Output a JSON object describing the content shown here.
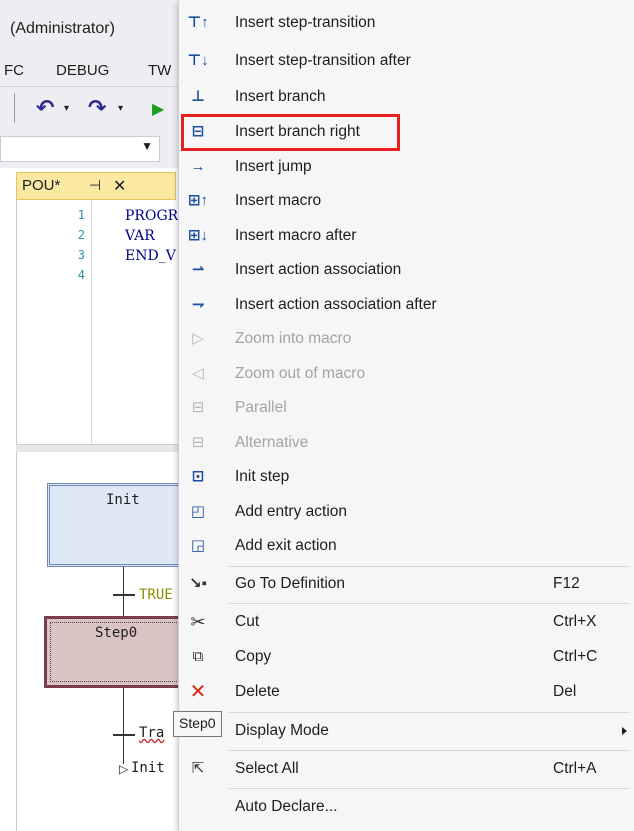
{
  "window": {
    "title": "(Administrator)"
  },
  "menubar": [
    "FC",
    "DEBUG",
    "TW"
  ],
  "toolbar": {
    "undo_icon": "undo-icon",
    "redo_icon": "redo-icon",
    "run_icon": "run-icon"
  },
  "editor": {
    "tab_label": "POU*",
    "line_numbers": [
      "1",
      "2",
      "3",
      "4"
    ],
    "code_lines": [
      "PROGR",
      "VAR",
      "END_V",
      ""
    ]
  },
  "sfc": {
    "init_step": "Init",
    "step0": "Step0",
    "transition_true": "TRUE",
    "transition_2": "Tra",
    "jump_target": "Init"
  },
  "tooltip": "Step0",
  "highlight_color": "#e81f1f",
  "context_menu": {
    "items": [
      {
        "label": "Insert step-transition",
        "icon": "insert-step-transition-icon",
        "enabled": true,
        "shortcut": ""
      },
      {
        "label": "Insert step-transition after",
        "icon": "insert-step-transition-after-icon",
        "enabled": true,
        "shortcut": ""
      },
      {
        "label": "Insert branch",
        "icon": "insert-branch-icon",
        "enabled": true,
        "shortcut": ""
      },
      {
        "label": "Insert branch right",
        "icon": "insert-branch-right-icon",
        "enabled": true,
        "shortcut": ""
      },
      {
        "label": "Insert jump",
        "icon": "insert-jump-icon",
        "enabled": true,
        "shortcut": ""
      },
      {
        "label": "Insert macro",
        "icon": "insert-macro-icon",
        "enabled": true,
        "shortcut": ""
      },
      {
        "label": "Insert macro after",
        "icon": "insert-macro-after-icon",
        "enabled": true,
        "shortcut": ""
      },
      {
        "label": "Insert action association",
        "icon": "insert-action-association-icon",
        "enabled": true,
        "shortcut": ""
      },
      {
        "label": "Insert action association after",
        "icon": "insert-action-association-after-icon",
        "enabled": true,
        "shortcut": ""
      },
      {
        "label": "Zoom into macro",
        "icon": "zoom-into-macro-icon",
        "enabled": false,
        "shortcut": ""
      },
      {
        "label": "Zoom out of macro",
        "icon": "zoom-out-of-macro-icon",
        "enabled": false,
        "shortcut": ""
      },
      {
        "label": "Parallel",
        "icon": "parallel-icon",
        "enabled": false,
        "shortcut": ""
      },
      {
        "label": "Alternative",
        "icon": "alternative-icon",
        "enabled": false,
        "shortcut": ""
      },
      {
        "label": "Init step",
        "icon": "init-step-icon",
        "enabled": true,
        "shortcut": ""
      },
      {
        "label": "Add entry action",
        "icon": "add-entry-action-icon",
        "enabled": true,
        "shortcut": ""
      },
      {
        "label": "Add exit action",
        "icon": "add-exit-action-icon",
        "enabled": true,
        "shortcut": ""
      },
      {
        "label": "Go To Definition",
        "icon": "go-to-definition-icon",
        "enabled": true,
        "shortcut": "F12"
      },
      {
        "label": "Cut",
        "icon": "scissors-icon",
        "enabled": true,
        "shortcut": "Ctrl+X"
      },
      {
        "label": "Copy",
        "icon": "copy-icon",
        "enabled": true,
        "shortcut": "Ctrl+C"
      },
      {
        "label": "Delete",
        "icon": "delete-icon",
        "enabled": true,
        "shortcut": "Del"
      },
      {
        "label": "Display Mode",
        "icon": "",
        "enabled": true,
        "shortcut": ""
      },
      {
        "label": "Select All",
        "icon": "select-all-icon",
        "enabled": true,
        "shortcut": "Ctrl+A"
      },
      {
        "label": "Auto Declare...",
        "icon": "",
        "enabled": true,
        "shortcut": ""
      }
    ]
  }
}
